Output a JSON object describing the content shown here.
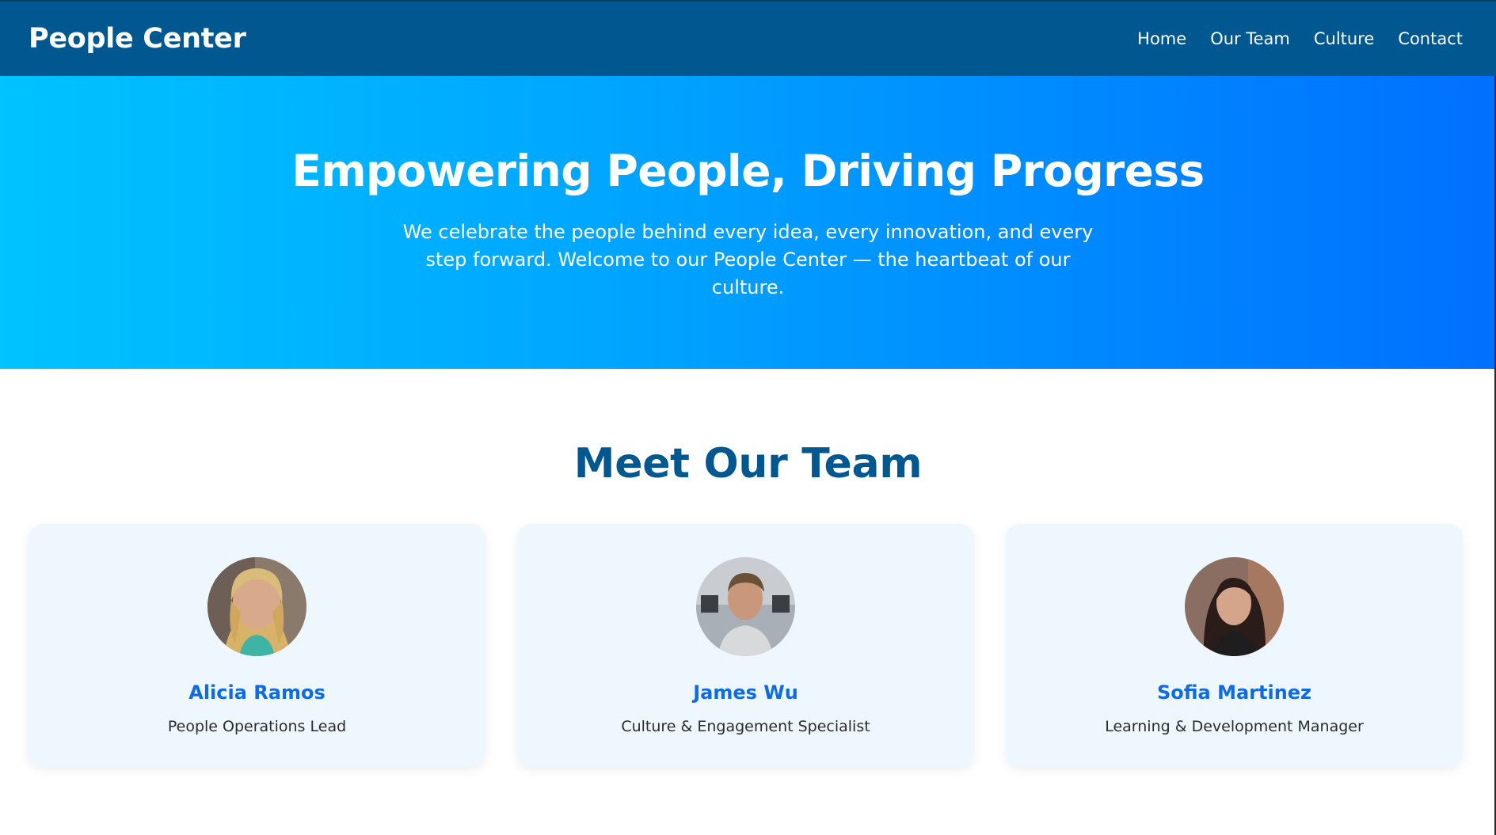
{
  "navbar": {
    "brand": "People Center",
    "links": [
      "Home",
      "Our Team",
      "Culture",
      "Contact"
    ]
  },
  "hero": {
    "title": "Empowering People, Driving Progress",
    "subtitle": "We celebrate the people behind every idea, every innovation, and every step forward. Welcome to our People Center — the heartbeat of our culture."
  },
  "team": {
    "title": "Meet Our Team",
    "members": [
      {
        "name": "Alicia Ramos",
        "role": "People Operations Lead"
      },
      {
        "name": "James Wu",
        "role": "Culture & Engagement Specialist"
      },
      {
        "name": "Sofia Martinez",
        "role": "Learning & Development Manager"
      }
    ]
  },
  "colors": {
    "navbar_bg": "#01578f",
    "hero_gradient_start": "#00c3ff",
    "hero_gradient_end": "#0070ff",
    "team_title": "#01578f",
    "member_name": "#0f6ae6",
    "card_bg": "#eef7fe"
  }
}
